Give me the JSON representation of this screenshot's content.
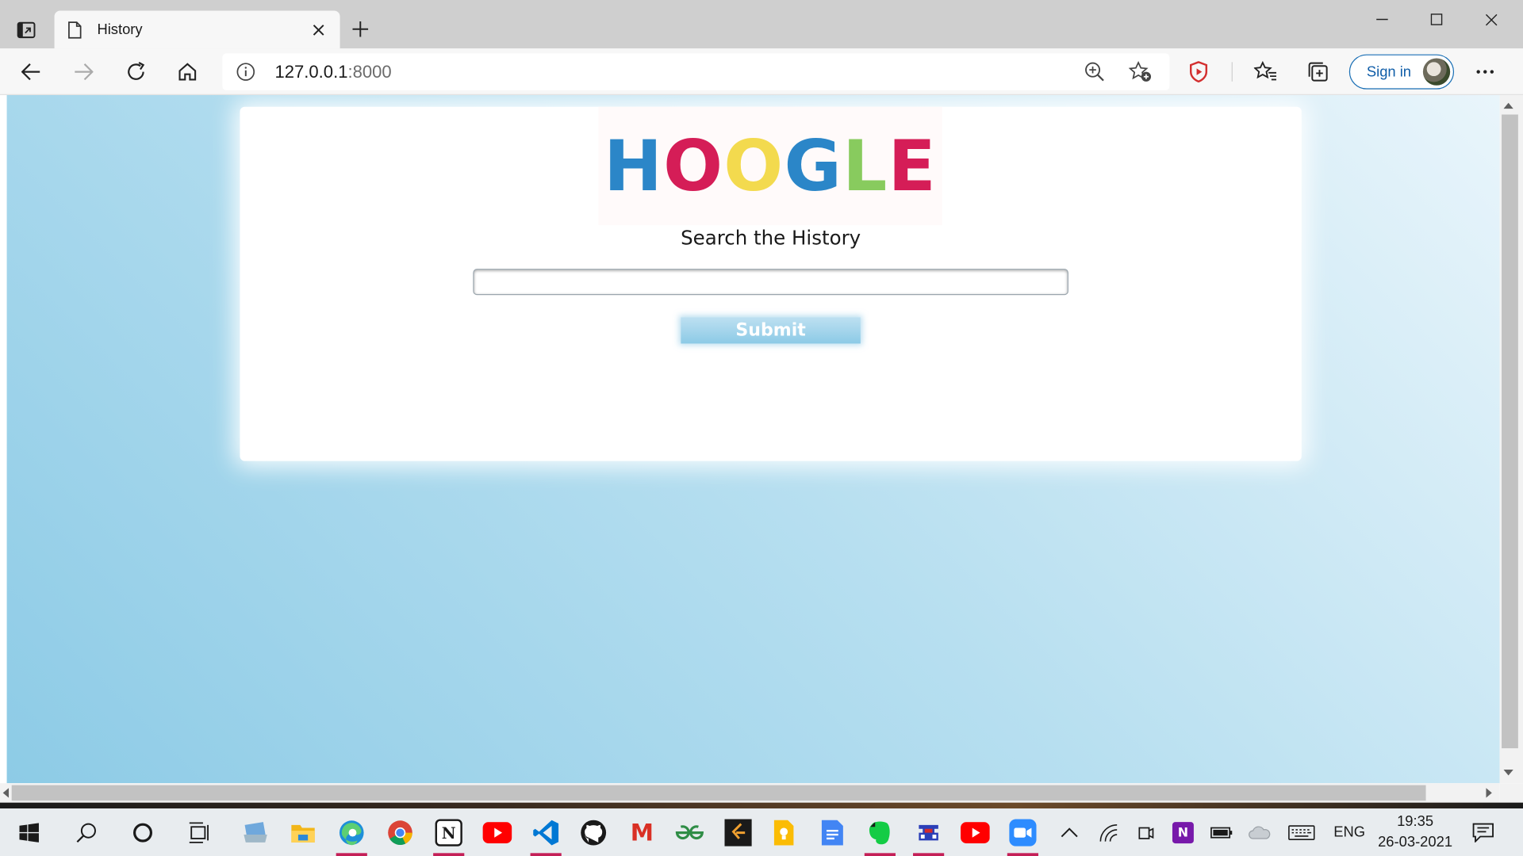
{
  "browser": {
    "tab_title": "History",
    "url_host": "127.0.0.1",
    "url_port": ":8000",
    "signin_label": "Sign in"
  },
  "page": {
    "logo_letters": [
      {
        "char": "H",
        "color": "#2b86c8"
      },
      {
        "char": "O",
        "color": "#d51d57"
      },
      {
        "char": "O",
        "color": "#f3da4e"
      },
      {
        "char": "G",
        "color": "#2b86c8"
      },
      {
        "char": "L",
        "color": "#88cb5e"
      },
      {
        "char": "E",
        "color": "#d51d57"
      }
    ],
    "heading": "Search the History",
    "search_value": "",
    "submit_label": "Submit"
  },
  "taskbar": {
    "apps": [
      {
        "name": "file-explorer-icon",
        "active": false
      },
      {
        "name": "folder-icon",
        "active": false
      },
      {
        "name": "edge-icon",
        "active": true
      },
      {
        "name": "chrome-icon",
        "active": false
      },
      {
        "name": "notion-icon",
        "active": true,
        "glyph": "N"
      },
      {
        "name": "youtube-icon",
        "active": false
      },
      {
        "name": "vscode-icon",
        "active": true
      },
      {
        "name": "github-icon",
        "active": false
      },
      {
        "name": "gmail-icon",
        "active": false,
        "glyph": "M"
      },
      {
        "name": "geeksforgeeks-icon",
        "active": false
      },
      {
        "name": "leetcode-icon",
        "active": false
      },
      {
        "name": "keep-icon",
        "active": false
      },
      {
        "name": "docs-icon",
        "active": false
      },
      {
        "name": "evernote-icon",
        "active": true
      },
      {
        "name": "game-icon",
        "active": true
      },
      {
        "name": "youtube-icon",
        "active": false
      },
      {
        "name": "zoom-icon",
        "active": true
      }
    ],
    "language": "ENG",
    "time": "19:35",
    "date": "26-03-2021"
  },
  "colors": {
    "accent": "#1a6fb5",
    "active_indicator": "#c41f57"
  }
}
